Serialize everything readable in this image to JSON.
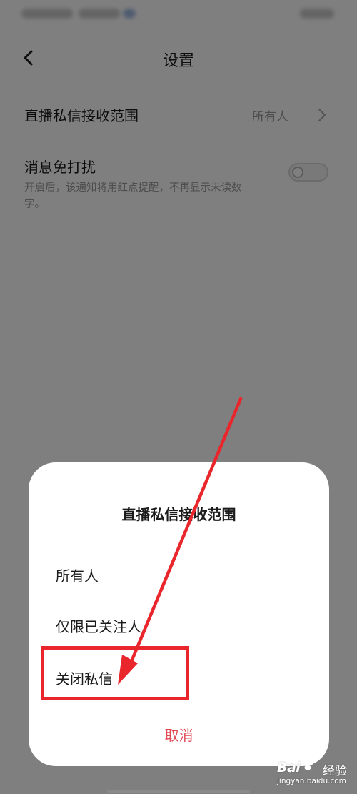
{
  "header": {
    "title": "设置"
  },
  "settings": {
    "dm_range": {
      "label": "直播私信接收范围",
      "value": "所有人"
    },
    "dnd": {
      "label": "消息免打扰",
      "description": "开启后，该通知将用红点提醒，不再显示未读数字。",
      "enabled": false
    }
  },
  "dialog": {
    "title": "直播私信接收范围",
    "options": [
      {
        "label": "所有人"
      },
      {
        "label": "仅限已关注人"
      },
      {
        "label": "关闭私信"
      }
    ],
    "cancel_label": "取消"
  },
  "watermark": {
    "brand": "Bai",
    "brand_suffix": "经验",
    "url": "jingyan.baidu.com"
  },
  "colors": {
    "annotation_red": "#e8262b",
    "cancel_red": "#e04a55"
  },
  "icons": {
    "back": "back-chevron-icon",
    "row_chevron": "chevron-right-icon",
    "watermark_paw": "paw-icon"
  }
}
